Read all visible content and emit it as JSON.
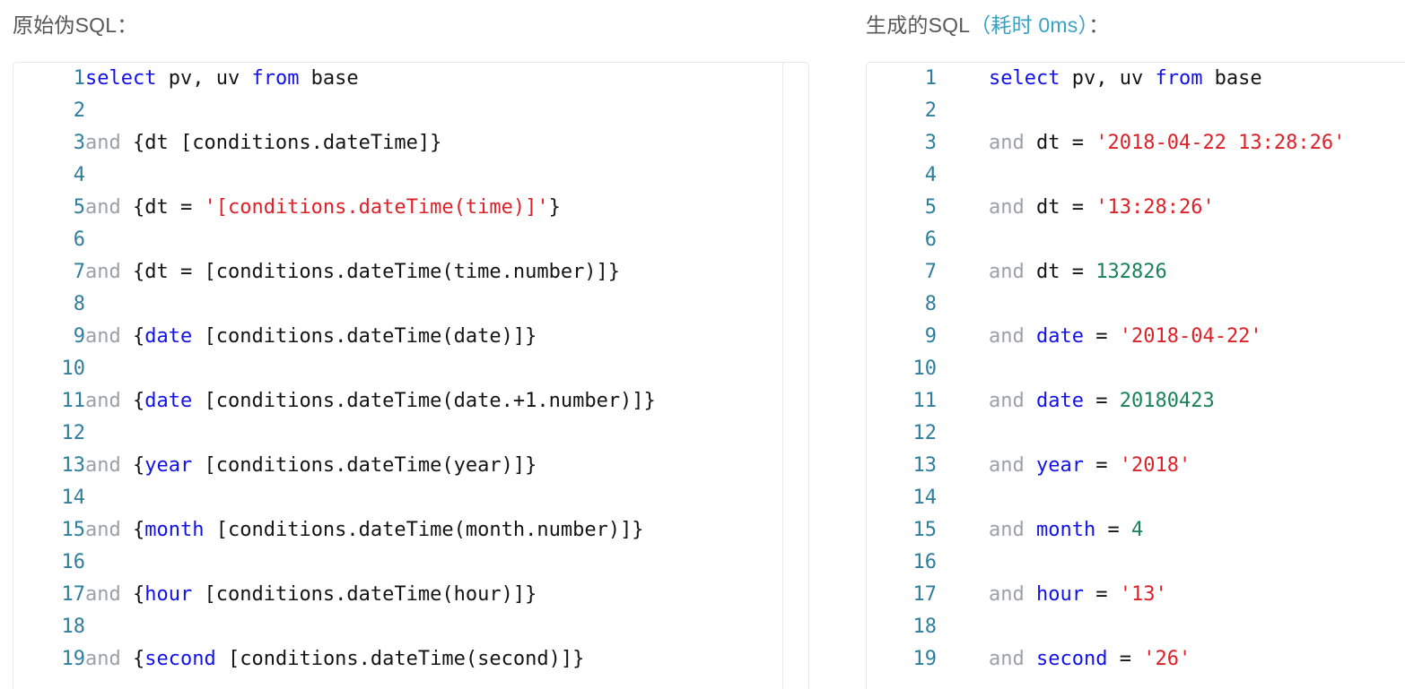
{
  "left_panel": {
    "title": "原始伪SQL：",
    "lines": [
      {
        "n": "1",
        "tokens": [
          {
            "t": "select",
            "c": "kw"
          },
          {
            "t": " pv, uv ",
            "c": "pl"
          },
          {
            "t": "from",
            "c": "kw"
          },
          {
            "t": " base",
            "c": "pl"
          }
        ]
      },
      {
        "n": "2",
        "tokens": []
      },
      {
        "n": "3",
        "tokens": [
          {
            "t": "and",
            "c": "and"
          },
          {
            "t": " {dt [conditions.dateTime]}",
            "c": "pl"
          }
        ]
      },
      {
        "n": "4",
        "tokens": []
      },
      {
        "n": "5",
        "tokens": [
          {
            "t": "and",
            "c": "and"
          },
          {
            "t": " {dt = ",
            "c": "pl"
          },
          {
            "t": "'[conditions.dateTime(time)]'",
            "c": "str"
          },
          {
            "t": "}",
            "c": "pl"
          }
        ]
      },
      {
        "n": "6",
        "tokens": []
      },
      {
        "n": "7",
        "tokens": [
          {
            "t": "and",
            "c": "and"
          },
          {
            "t": " {dt = [conditions.dateTime(time.number)]}",
            "c": "pl"
          }
        ]
      },
      {
        "n": "8",
        "tokens": []
      },
      {
        "n": "9",
        "tokens": [
          {
            "t": "and",
            "c": "and"
          },
          {
            "t": " {",
            "c": "pl"
          },
          {
            "t": "date",
            "c": "kw"
          },
          {
            "t": " [conditions.dateTime(date)]}",
            "c": "pl"
          }
        ]
      },
      {
        "n": "10",
        "tokens": []
      },
      {
        "n": "11",
        "tokens": [
          {
            "t": "and",
            "c": "and"
          },
          {
            "t": " {",
            "c": "pl"
          },
          {
            "t": "date",
            "c": "kw"
          },
          {
            "t": " [conditions.dateTime(date.+1.number)]}",
            "c": "pl"
          }
        ]
      },
      {
        "n": "12",
        "tokens": []
      },
      {
        "n": "13",
        "tokens": [
          {
            "t": "and",
            "c": "and"
          },
          {
            "t": " {",
            "c": "pl"
          },
          {
            "t": "year",
            "c": "kw"
          },
          {
            "t": " [conditions.dateTime(year)]}",
            "c": "pl"
          }
        ]
      },
      {
        "n": "14",
        "tokens": []
      },
      {
        "n": "15",
        "tokens": [
          {
            "t": "and",
            "c": "and"
          },
          {
            "t": " {",
            "c": "pl"
          },
          {
            "t": "month",
            "c": "kw"
          },
          {
            "t": " [conditions.dateTime(month.number)]}",
            "c": "pl"
          }
        ]
      },
      {
        "n": "16",
        "tokens": []
      },
      {
        "n": "17",
        "tokens": [
          {
            "t": "and",
            "c": "and"
          },
          {
            "t": " {",
            "c": "pl"
          },
          {
            "t": "hour",
            "c": "kw"
          },
          {
            "t": " [conditions.dateTime(hour)]}",
            "c": "pl"
          }
        ]
      },
      {
        "n": "18",
        "tokens": []
      },
      {
        "n": "19",
        "tokens": [
          {
            "t": "and",
            "c": "and"
          },
          {
            "t": " {",
            "c": "pl"
          },
          {
            "t": "second",
            "c": "kw"
          },
          {
            "t": " [conditions.dateTime(second)]}",
            "c": "pl"
          }
        ]
      }
    ]
  },
  "right_panel": {
    "title_main": "生成的SQL",
    "title_accent": "（耗时 0ms）",
    "title_suffix": "：",
    "elapsed_label": "耗时",
    "elapsed_value": "0ms",
    "lines": [
      {
        "n": "1",
        "tokens": [
          {
            "t": "select",
            "c": "kw"
          },
          {
            "t": " pv, uv ",
            "c": "pl"
          },
          {
            "t": "from",
            "c": "kw"
          },
          {
            "t": " base",
            "c": "pl"
          }
        ]
      },
      {
        "n": "2",
        "tokens": []
      },
      {
        "n": "3",
        "tokens": [
          {
            "t": "and",
            "c": "and"
          },
          {
            "t": " dt = ",
            "c": "pl"
          },
          {
            "t": "'2018-04-22 13:28:26'",
            "c": "str"
          }
        ]
      },
      {
        "n": "4",
        "tokens": []
      },
      {
        "n": "5",
        "tokens": [
          {
            "t": "and",
            "c": "and"
          },
          {
            "t": " dt = ",
            "c": "pl"
          },
          {
            "t": "'13:28:26'",
            "c": "str"
          }
        ]
      },
      {
        "n": "6",
        "tokens": []
      },
      {
        "n": "7",
        "tokens": [
          {
            "t": "and",
            "c": "and"
          },
          {
            "t": " dt = ",
            "c": "pl"
          },
          {
            "t": "132826",
            "c": "num"
          }
        ]
      },
      {
        "n": "8",
        "tokens": []
      },
      {
        "n": "9",
        "tokens": [
          {
            "t": "and",
            "c": "and"
          },
          {
            "t": " ",
            "c": "pl"
          },
          {
            "t": "date",
            "c": "kw"
          },
          {
            "t": " = ",
            "c": "pl"
          },
          {
            "t": "'2018-04-22'",
            "c": "str"
          }
        ]
      },
      {
        "n": "10",
        "tokens": []
      },
      {
        "n": "11",
        "tokens": [
          {
            "t": "and",
            "c": "and"
          },
          {
            "t": " ",
            "c": "pl"
          },
          {
            "t": "date",
            "c": "kw"
          },
          {
            "t": " = ",
            "c": "pl"
          },
          {
            "t": "20180423",
            "c": "num"
          }
        ]
      },
      {
        "n": "12",
        "tokens": []
      },
      {
        "n": "13",
        "tokens": [
          {
            "t": "and",
            "c": "and"
          },
          {
            "t": " ",
            "c": "pl"
          },
          {
            "t": "year",
            "c": "kw"
          },
          {
            "t": " = ",
            "c": "pl"
          },
          {
            "t": "'2018'",
            "c": "str"
          }
        ]
      },
      {
        "n": "14",
        "tokens": []
      },
      {
        "n": "15",
        "tokens": [
          {
            "t": "and",
            "c": "and"
          },
          {
            "t": " ",
            "c": "pl"
          },
          {
            "t": "month",
            "c": "kw"
          },
          {
            "t": " = ",
            "c": "pl"
          },
          {
            "t": "4",
            "c": "num"
          }
        ]
      },
      {
        "n": "16",
        "tokens": []
      },
      {
        "n": "17",
        "tokens": [
          {
            "t": "and",
            "c": "and"
          },
          {
            "t": " ",
            "c": "pl"
          },
          {
            "t": "hour",
            "c": "kw"
          },
          {
            "t": " = ",
            "c": "pl"
          },
          {
            "t": "'13'",
            "c": "str"
          }
        ]
      },
      {
        "n": "18",
        "tokens": []
      },
      {
        "n": "19",
        "tokens": [
          {
            "t": "and",
            "c": "and"
          },
          {
            "t": " ",
            "c": "pl"
          },
          {
            "t": "second",
            "c": "kw"
          },
          {
            "t": " = ",
            "c": "pl"
          },
          {
            "t": "'26'",
            "c": "str"
          }
        ]
      }
    ]
  },
  "theme": {
    "keyword_color": "#1212e8",
    "string_color": "#dc2128",
    "number_color": "#1b8257",
    "and_color": "#9aa1a8",
    "plain_color": "#141414",
    "gutter_color": "#2e7e9c",
    "title_color": "#585858",
    "accent_color": "#38a3c4",
    "panel_border_color": "#e8e8e8",
    "background_color": "#ffffff"
  }
}
